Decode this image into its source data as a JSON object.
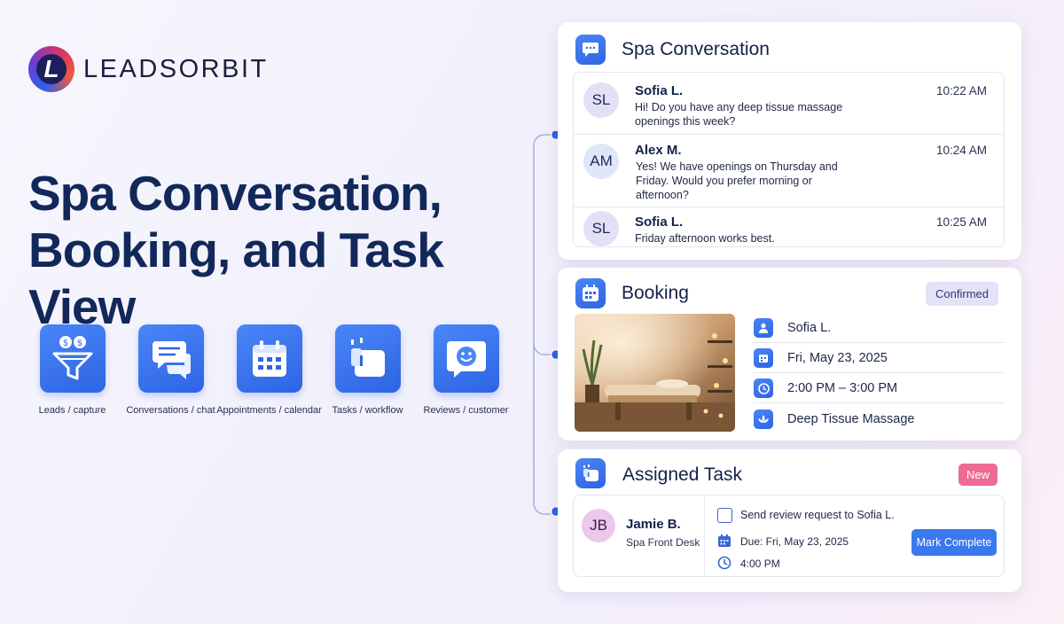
{
  "brand": {
    "logo_letter": "L",
    "name": "LEADSORBIT"
  },
  "headline": {
    "line1": "Spa Conversation,",
    "line2": "Booking, and Task View"
  },
  "features": [
    {
      "label": "Leads / capture",
      "icon": "funnel-icon"
    },
    {
      "label": "Conversations / chat",
      "icon": "chat-bubbles-icon"
    },
    {
      "label": "Appointments / calendar",
      "icon": "calendar-icon"
    },
    {
      "label": "Tasks / workflow",
      "icon": "task-icon"
    },
    {
      "label": "Reviews / customer",
      "icon": "smiley-review-icon"
    }
  ],
  "conversation": {
    "title": "Spa Conversation",
    "messages": [
      {
        "initials": "SL",
        "name": "Sofia L.",
        "time": "10:22 AM",
        "text": "Hi! Do you have any deep tissue massage openings this week?"
      },
      {
        "initials": "AM",
        "name": "Alex M.",
        "time": "10:24 AM",
        "text": "Yes! We have openings on Thursday and Friday. Would you prefer morning or afternoon?"
      },
      {
        "initials": "SL",
        "name": "Sofia L.",
        "time": "10:25 AM",
        "text": "Friday afternoon works best."
      }
    ]
  },
  "booking": {
    "title": "Booking",
    "status": "Confirmed",
    "client": "Sofia L.",
    "date": "Fri, May 23, 2025",
    "time": "2:00 PM – 3:00 PM",
    "service": "Deep Tissue Massage"
  },
  "task": {
    "title": "Assigned Task",
    "badge": "New",
    "assignee_initials": "JB",
    "assignee_name": "Jamie B.",
    "assignee_role": "Spa Front Desk",
    "description": "Send review request to Sofia L.",
    "due": "Due: Fri, May 23, 2025",
    "time": "4:00 PM",
    "action_label": "Mark Complete"
  },
  "colors": {
    "accent": "#3a78ef",
    "headline": "#12285a",
    "badge_new": "#ee6b93",
    "badge_confirmed": "#e3e3f7"
  }
}
